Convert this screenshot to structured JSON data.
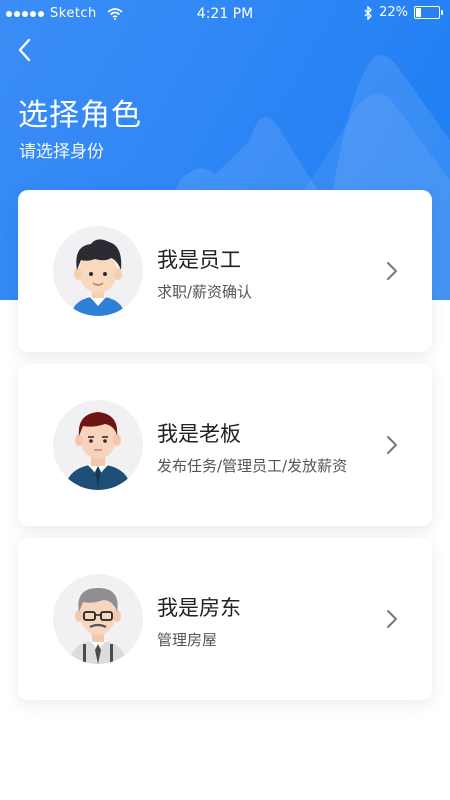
{
  "status_bar": {
    "carrier": "Sketch",
    "time": "4:21 PM",
    "battery": "22%",
    "battery_level": 0.22
  },
  "header": {
    "back_icon": "chevron-left-icon",
    "title": "选择角色",
    "subtitle": "请选择身份"
  },
  "roles": [
    {
      "title": "我是员工",
      "description": "求职/薪资确认",
      "avatar": "young-employee-avatar"
    },
    {
      "title": "我是老板",
      "description": "发布任务/管理员工/发放薪资",
      "avatar": "boss-avatar"
    },
    {
      "title": "我是房东",
      "description": "管理房屋",
      "avatar": "landlord-avatar"
    }
  ],
  "colors": {
    "header_gradient_start": "#3b8df5",
    "header_gradient_end": "#1b7df3",
    "card_background": "#ffffff",
    "title_text": "#222222",
    "description_text": "#555555"
  }
}
